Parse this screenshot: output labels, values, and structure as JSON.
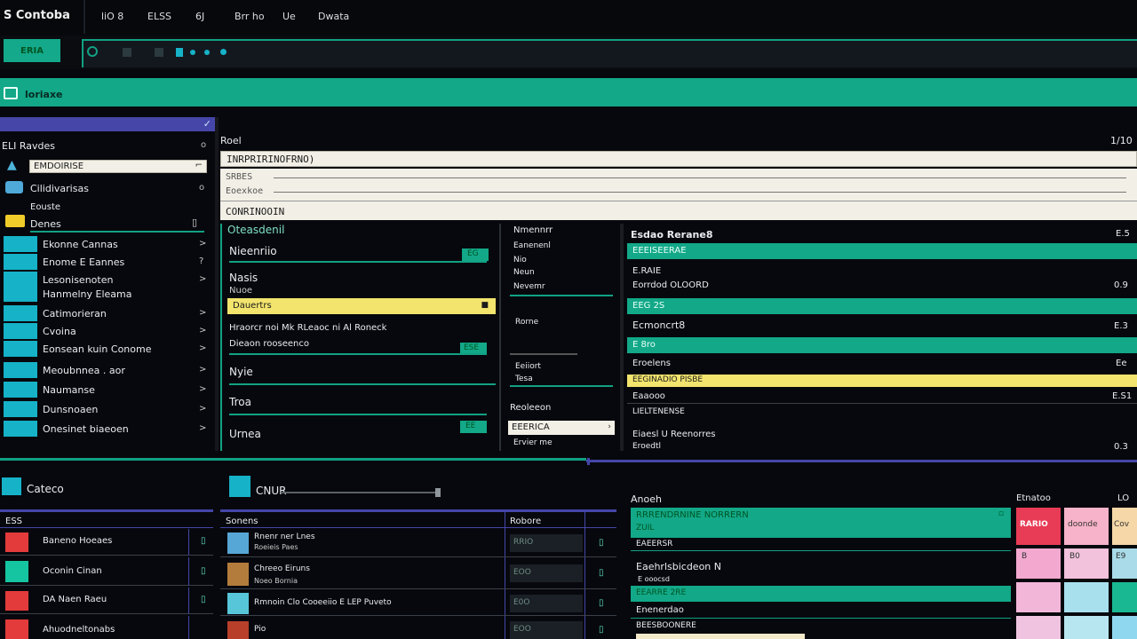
{
  "titlebar": {
    "app_title": "S Contoba",
    "menu": [
      "liO 8",
      "ELSS",
      "6J",
      "Brr ho",
      "Ue",
      "Dwata"
    ]
  },
  "tabbar": {
    "active_tab": "ERIA"
  },
  "banner": {
    "title": "loriaxe"
  },
  "sidebar": {
    "header_icon": "check-icon",
    "title": "ELI Ravdes",
    "title_count": "o",
    "search_value": "EMDOIRISE",
    "group1_label": "Cilidivarisas",
    "group1_count": "o",
    "group2_label": "Eouste",
    "group2_sub": "Denes",
    "items": [
      {
        "label": "Ekonne Cannas",
        "count": ">"
      },
      {
        "label": "Enome E Eannes",
        "count": "?"
      },
      {
        "label": "Lesonisenoten",
        "count": ">"
      },
      {
        "label": "Hanmelny Eleama",
        "count": ""
      },
      {
        "label": "Catimorieran",
        "count": ">"
      },
      {
        "label": "Cvoina",
        "count": ">"
      },
      {
        "label": "Eonsean kuin Conome",
        "count": ">"
      },
      {
        "label": "Meoubnnea . aor",
        "count": ">"
      },
      {
        "label": "Naumanse",
        "count": ">"
      },
      {
        "label": "Dunsnoaen",
        "count": ">"
      },
      {
        "label": "Onesinet biaeoen",
        "count": ">"
      }
    ]
  },
  "main_top": {
    "title": "Roel",
    "counter": "1/10",
    "input_value": "INRPRIRINOFRNO)",
    "line1": "SRBES",
    "line2": "Eoexkoe",
    "input2_value": "CONRINOOIN"
  },
  "left_form": {
    "title": "Oteasdenil",
    "rows": [
      {
        "label": "Nieenriio",
        "tag": "EG"
      },
      {
        "label": "Nasis",
        "sub": "Nuoe"
      },
      {
        "label": "Dauertrs",
        "highlight": true
      },
      {
        "label": "Hraorcr noi Mk RLeaoc ni Al Roneck",
        "sub": "Dieaon rooseenco",
        "tag": "ESE"
      },
      {
        "label": "Nyie"
      },
      {
        "label": "Troa"
      },
      {
        "label": "Urnea",
        "tag": "EE"
      }
    ]
  },
  "mid_panel": {
    "title": "Nmennrr",
    "items": [
      "Eanenenl",
      "Nio",
      "Neun",
      "Nevemr"
    ],
    "metric1": "Rorne",
    "metric2": "Eeiiort",
    "metric3": "Tesa",
    "label": "Reoleeon",
    "select_value": "EEERICA",
    "footer": "Ervier me"
  },
  "right_list": {
    "title": "Esdao Rerane8",
    "count": "E.5",
    "rows": [
      {
        "label": "EEEISEERAE",
        "style": "teal",
        "value": ""
      },
      {
        "label": "E.RAIE",
        "sub": "Eorrdod OLOORD",
        "style": "plain",
        "value": "0.9"
      },
      {
        "label": "EEG 2S",
        "style": "teal",
        "value": ""
      },
      {
        "label": "Ecmoncrt8",
        "style": "plain",
        "value": "E.3"
      },
      {
        "label": "E 8ro",
        "style": "teal",
        "value": ""
      },
      {
        "label": "Eroelens",
        "style": "plain",
        "value": "Ee"
      },
      {
        "label": "EEGINADIO PISBE",
        "style": "yellow",
        "value": ""
      },
      {
        "label": "Eaaooo",
        "style": "plain",
        "value": "E.S1"
      },
      {
        "label": "LIELTENENSE",
        "style": "plain",
        "value": ""
      },
      {
        "label": "Eiaesl U Reenorres",
        "sub": "Eroedtl",
        "style": "plain",
        "value": "0.3"
      }
    ]
  },
  "bottom_left": {
    "title": "Cateco",
    "col": "ESS",
    "rows": [
      {
        "label": "Baneno Hoeaes",
        "color": "#e33b3b"
      },
      {
        "label": "Oconin Cinan",
        "color": "#15c4a0"
      },
      {
        "label": "DA Naen Raeu",
        "color": "#e33b3b"
      },
      {
        "label": "Ahuodneltonabs",
        "color": "#e33b3b"
      }
    ]
  },
  "bottom_mid": {
    "title": "CNUR",
    "col1": "Sonens",
    "col2": "Robore",
    "rows": [
      {
        "label": "Rnenr ner Lnes",
        "sub": "Roeieis Paes",
        "value": "RRIO"
      },
      {
        "label": "Chreeo Eiruns",
        "sub": "Noeo Bornia",
        "value": "EOO"
      },
      {
        "label": "Rmnoin Clo Cooeeiio E LEP Puveto",
        "sub": "",
        "value": "E0O"
      },
      {
        "label": "Pio",
        "sub": "",
        "value": "EOO"
      }
    ]
  },
  "bottom_right": {
    "title": "Anoeh",
    "block_header": "RRRENDRNINE NORRERN",
    "block_sub": "ZUIL",
    "line1": "EAEERSR",
    "line2": "Eaehrlsbicdeon N",
    "line2_sub": "E ooocsd",
    "teal2": "EEARRE 2RE",
    "line3": "Enenerdao",
    "line4": "BEESBOONERE"
  },
  "swatches": {
    "title": "Etnatoo",
    "corner": "LO",
    "cells": [
      {
        "label": "RARIO",
        "color": "#e83b55"
      },
      {
        "label": "doonde",
        "color": "#f7b3c9"
      },
      {
        "label": "Cov",
        "color": "#f5d7a8"
      },
      {
        "label": "B",
        "color": "#f3a9cf"
      },
      {
        "label": "B0",
        "color": "#f2c1db"
      },
      {
        "label": "E9",
        "color": "#a9dbe8"
      },
      {
        "label": "",
        "color": "#f2b6d8"
      },
      {
        "label": "",
        "color": "#a8e0ee"
      },
      {
        "label": "",
        "color": "#19b892"
      },
      {
        "label": "",
        "color": "#f0c4e0"
      },
      {
        "label": "",
        "color": "#b8e6f0"
      },
      {
        "label": "",
        "color": "#8fd7ee"
      }
    ]
  }
}
